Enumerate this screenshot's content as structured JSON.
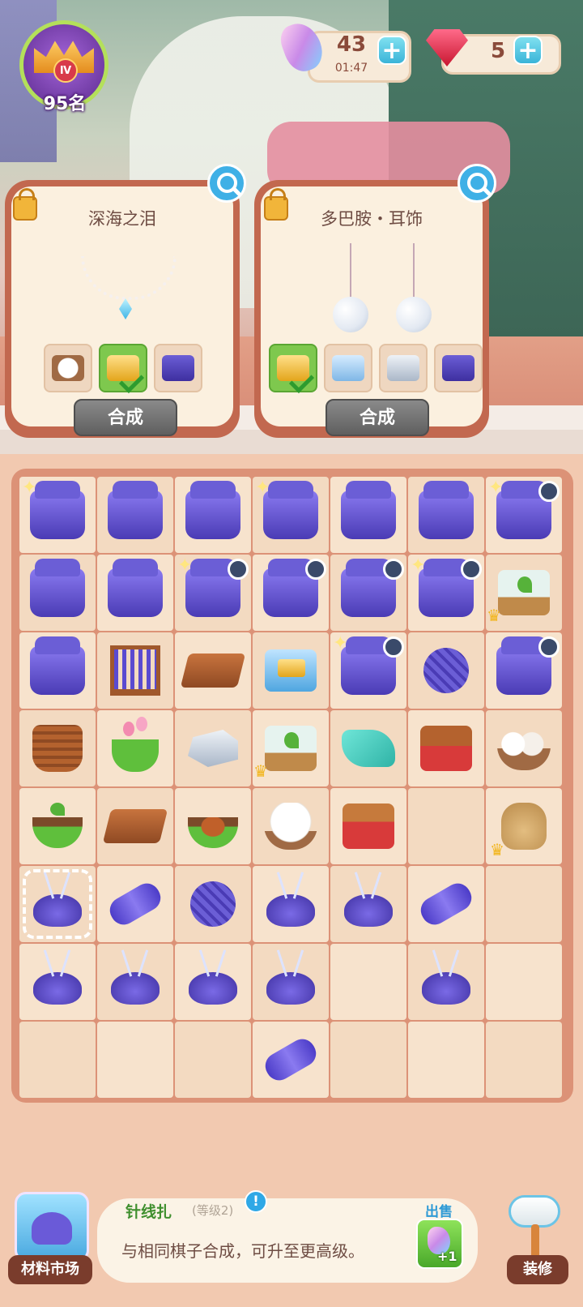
{
  "hud": {
    "rank_badge": "Ⅳ",
    "rank_label": "95名",
    "energy_value": "43",
    "energy_timer": "01:47",
    "gem_value": "5"
  },
  "orders": [
    {
      "title": "深海之泪",
      "combine_label": "合成",
      "requirements": [
        {
          "icon": "cotton-bowl-icon",
          "done": false
        },
        {
          "icon": "gold-chest-icon",
          "done": true
        },
        {
          "icon": "sewing-machine-icon",
          "done": false
        }
      ]
    },
    {
      "title": "多巴胺・耳饰",
      "combine_label": "合成",
      "requirements": [
        {
          "icon": "gold-chest-icon",
          "done": true
        },
        {
          "icon": "silver-box-icon",
          "done": false
        },
        {
          "icon": "silver-bars-icon",
          "done": false
        },
        {
          "icon": "sewing-machine-icon",
          "done": false
        }
      ]
    }
  ],
  "board": [
    [
      "sewing-box",
      "sewing-box",
      "sewing-box",
      "sewing-box",
      "sewing-box",
      "sewing-box",
      "sewing-box-timer"
    ],
    [
      "sewing-box",
      "sewing-box",
      "sewing-box-timer",
      "sewing-box-timer",
      "sewing-box-timer",
      "sewing-box-timer",
      "sprout-box-crown"
    ],
    [
      "sewing-box",
      "loom",
      "wood-planks",
      "gold-chest",
      "sewing-box-timer",
      "yarn",
      "sewing-box-timer"
    ],
    [
      "log-basket",
      "flower-pot",
      "silver-bars",
      "sprout-box-crown",
      "teal-cloth",
      "log-crate",
      "towel-bowl"
    ],
    [
      "seedling-bowl",
      "wood-planks",
      "soil-bowl",
      "cotton-bowl",
      "log-crate-red",
      "",
      "seed-sack-crown"
    ],
    [
      "pincushion-selected",
      "thread-spool",
      "yarn",
      "pincushion",
      "pincushion",
      "thread-spool",
      ""
    ],
    [
      "pincushion",
      "pincushion",
      "pincushion",
      "pincushion",
      "",
      "pincushion",
      ""
    ],
    [
      "",
      "",
      "",
      "thread-spool",
      "",
      "",
      ""
    ]
  ],
  "info": {
    "item_name": "针线扎",
    "item_level": "(等级2)",
    "alert": "!",
    "description": "与相同棋子合成，可升至更高级。",
    "sell_label": "出售",
    "sell_reward": "+1"
  },
  "buttons": {
    "market_label": "材料市场",
    "decorate_label": "装修"
  },
  "colors": {
    "accent_blue": "#3fb0e6",
    "accent_green": "#7ec84e",
    "board_frame": "#dc9277",
    "card_frame": "#c2684f"
  }
}
